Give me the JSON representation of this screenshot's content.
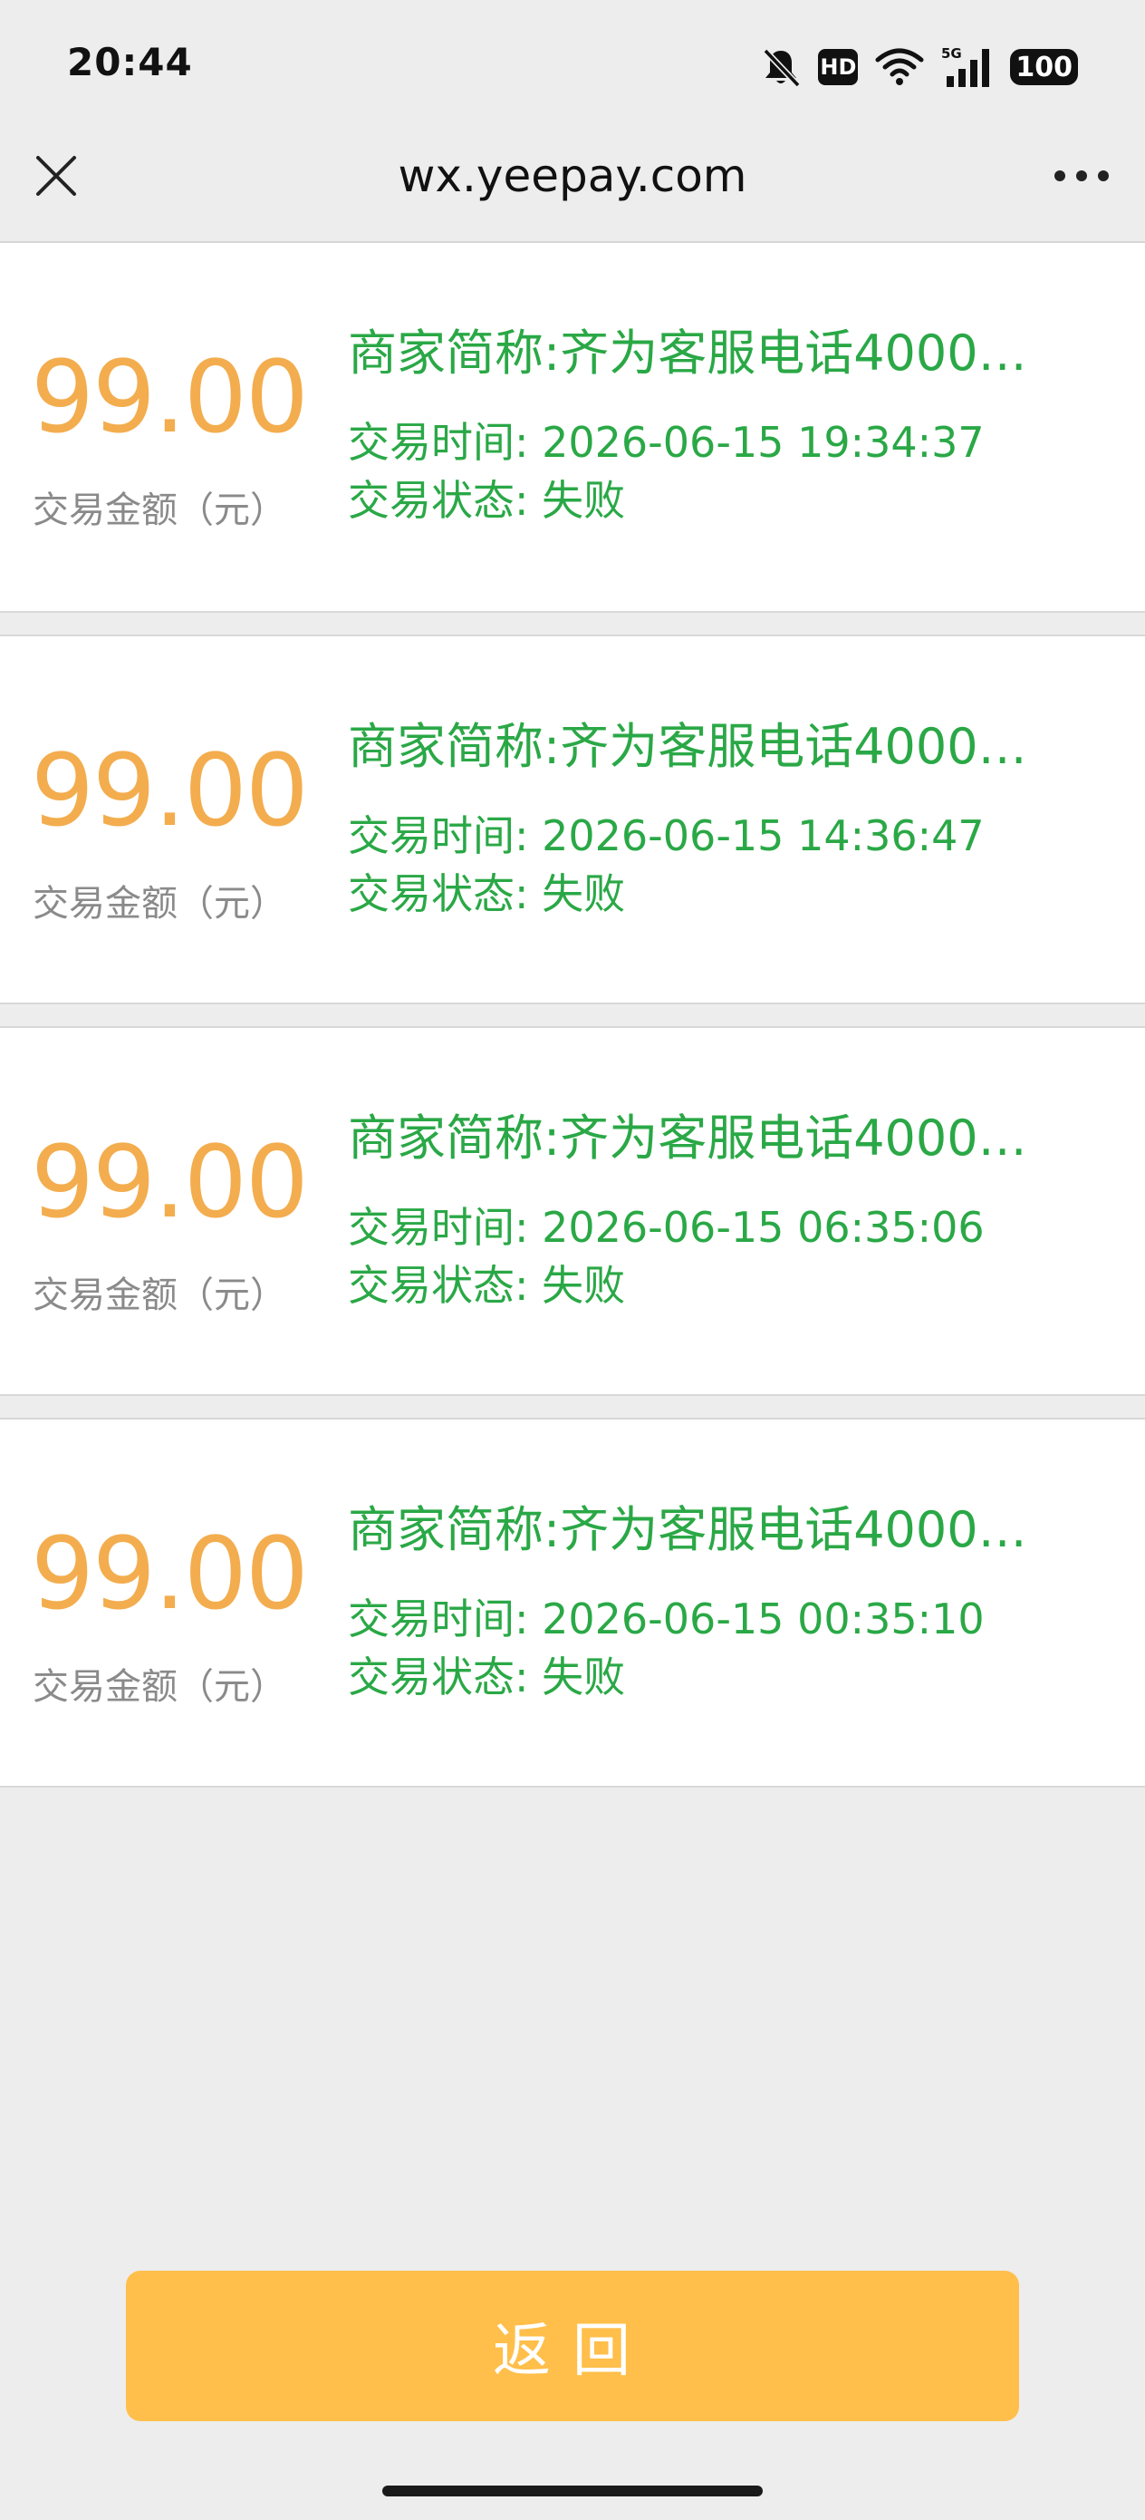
{
  "status_bar": {
    "time": "20:44",
    "icons": [
      "bell-off-icon",
      "hd-icon",
      "wifi-icon",
      "5g-signal-icon",
      "battery-icon"
    ],
    "hd_label": "HD",
    "battery": "100"
  },
  "nav": {
    "title": "wx.yeepay.com",
    "close_icon": "close-icon",
    "more_icon": "more-icon"
  },
  "records": [
    {
      "amount": "99.00",
      "amount_label": "交易金额（元）",
      "merchant": "商家简称:齐为客服电话4000…",
      "time": "交易时间: 2026-06-15 19:34:37",
      "status": "交易状态: 失败"
    },
    {
      "amount": "99.00",
      "amount_label": "交易金额（元）",
      "merchant": "商家简称:齐为客服电话4000…",
      "time": "交易时间: 2026-06-15 14:36:47",
      "status": "交易状态: 失败"
    },
    {
      "amount": "99.00",
      "amount_label": "交易金额（元）",
      "merchant": "商家简称:齐为客服电话4000…",
      "time": "交易时间: 2026-06-15 06:35:06",
      "status": "交易状态: 失败"
    },
    {
      "amount": "99.00",
      "amount_label": "交易金额（元）",
      "merchant": "商家简称:齐为客服电话4000…",
      "time": "交易时间: 2026-06-15 00:35:10",
      "status": "交易状态: 失败"
    }
  ],
  "return_button": {
    "label": "返回"
  },
  "colors": {
    "amount": "#f3ad4e",
    "detail_text": "#2aa846",
    "button": "#ffbf4a",
    "background": "#ededed"
  }
}
